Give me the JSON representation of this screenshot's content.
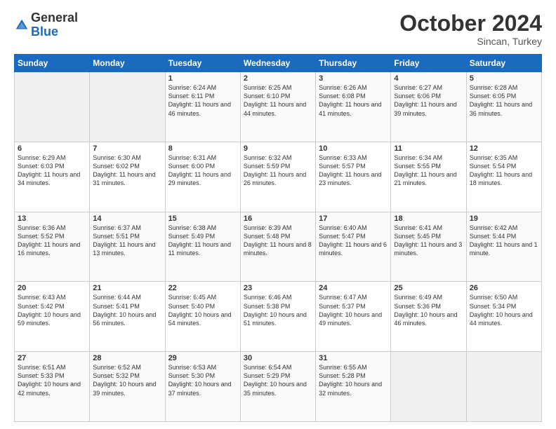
{
  "header": {
    "logo_general": "General",
    "logo_blue": "Blue",
    "month": "October 2024",
    "location": "Sincan, Turkey"
  },
  "days_of_week": [
    "Sunday",
    "Monday",
    "Tuesday",
    "Wednesday",
    "Thursday",
    "Friday",
    "Saturday"
  ],
  "weeks": [
    [
      {
        "day": "",
        "info": ""
      },
      {
        "day": "",
        "info": ""
      },
      {
        "day": "1",
        "sunrise": "6:24 AM",
        "sunset": "6:11 PM",
        "daylight": "11 hours and 46 minutes."
      },
      {
        "day": "2",
        "sunrise": "6:25 AM",
        "sunset": "6:10 PM",
        "daylight": "11 hours and 44 minutes."
      },
      {
        "day": "3",
        "sunrise": "6:26 AM",
        "sunset": "6:08 PM",
        "daylight": "11 hours and 41 minutes."
      },
      {
        "day": "4",
        "sunrise": "6:27 AM",
        "sunset": "6:06 PM",
        "daylight": "11 hours and 39 minutes."
      },
      {
        "day": "5",
        "sunrise": "6:28 AM",
        "sunset": "6:05 PM",
        "daylight": "11 hours and 36 minutes."
      }
    ],
    [
      {
        "day": "6",
        "sunrise": "6:29 AM",
        "sunset": "6:03 PM",
        "daylight": "11 hours and 34 minutes."
      },
      {
        "day": "7",
        "sunrise": "6:30 AM",
        "sunset": "6:02 PM",
        "daylight": "11 hours and 31 minutes."
      },
      {
        "day": "8",
        "sunrise": "6:31 AM",
        "sunset": "6:00 PM",
        "daylight": "11 hours and 29 minutes."
      },
      {
        "day": "9",
        "sunrise": "6:32 AM",
        "sunset": "5:59 PM",
        "daylight": "11 hours and 26 minutes."
      },
      {
        "day": "10",
        "sunrise": "6:33 AM",
        "sunset": "5:57 PM",
        "daylight": "11 hours and 23 minutes."
      },
      {
        "day": "11",
        "sunrise": "6:34 AM",
        "sunset": "5:55 PM",
        "daylight": "11 hours and 21 minutes."
      },
      {
        "day": "12",
        "sunrise": "6:35 AM",
        "sunset": "5:54 PM",
        "daylight": "11 hours and 18 minutes."
      }
    ],
    [
      {
        "day": "13",
        "sunrise": "6:36 AM",
        "sunset": "5:52 PM",
        "daylight": "11 hours and 16 minutes."
      },
      {
        "day": "14",
        "sunrise": "6:37 AM",
        "sunset": "5:51 PM",
        "daylight": "11 hours and 13 minutes."
      },
      {
        "day": "15",
        "sunrise": "6:38 AM",
        "sunset": "5:49 PM",
        "daylight": "11 hours and 11 minutes."
      },
      {
        "day": "16",
        "sunrise": "6:39 AM",
        "sunset": "5:48 PM",
        "daylight": "11 hours and 8 minutes."
      },
      {
        "day": "17",
        "sunrise": "6:40 AM",
        "sunset": "5:47 PM",
        "daylight": "11 hours and 6 minutes."
      },
      {
        "day": "18",
        "sunrise": "6:41 AM",
        "sunset": "5:45 PM",
        "daylight": "11 hours and 3 minutes."
      },
      {
        "day": "19",
        "sunrise": "6:42 AM",
        "sunset": "5:44 PM",
        "daylight": "11 hours and 1 minute."
      }
    ],
    [
      {
        "day": "20",
        "sunrise": "6:43 AM",
        "sunset": "5:42 PM",
        "daylight": "10 hours and 59 minutes."
      },
      {
        "day": "21",
        "sunrise": "6:44 AM",
        "sunset": "5:41 PM",
        "daylight": "10 hours and 56 minutes."
      },
      {
        "day": "22",
        "sunrise": "6:45 AM",
        "sunset": "5:40 PM",
        "daylight": "10 hours and 54 minutes."
      },
      {
        "day": "23",
        "sunrise": "6:46 AM",
        "sunset": "5:38 PM",
        "daylight": "10 hours and 51 minutes."
      },
      {
        "day": "24",
        "sunrise": "6:47 AM",
        "sunset": "5:37 PM",
        "daylight": "10 hours and 49 minutes."
      },
      {
        "day": "25",
        "sunrise": "6:49 AM",
        "sunset": "5:36 PM",
        "daylight": "10 hours and 46 minutes."
      },
      {
        "day": "26",
        "sunrise": "6:50 AM",
        "sunset": "5:34 PM",
        "daylight": "10 hours and 44 minutes."
      }
    ],
    [
      {
        "day": "27",
        "sunrise": "6:51 AM",
        "sunset": "5:33 PM",
        "daylight": "10 hours and 42 minutes."
      },
      {
        "day": "28",
        "sunrise": "6:52 AM",
        "sunset": "5:32 PM",
        "daylight": "10 hours and 39 minutes."
      },
      {
        "day": "29",
        "sunrise": "6:53 AM",
        "sunset": "5:30 PM",
        "daylight": "10 hours and 37 minutes."
      },
      {
        "day": "30",
        "sunrise": "6:54 AM",
        "sunset": "5:29 PM",
        "daylight": "10 hours and 35 minutes."
      },
      {
        "day": "31",
        "sunrise": "6:55 AM",
        "sunset": "5:28 PM",
        "daylight": "10 hours and 32 minutes."
      },
      {
        "day": "",
        "info": ""
      },
      {
        "day": "",
        "info": ""
      }
    ]
  ],
  "labels": {
    "sunrise": "Sunrise:",
    "sunset": "Sunset:",
    "daylight": "Daylight:"
  }
}
